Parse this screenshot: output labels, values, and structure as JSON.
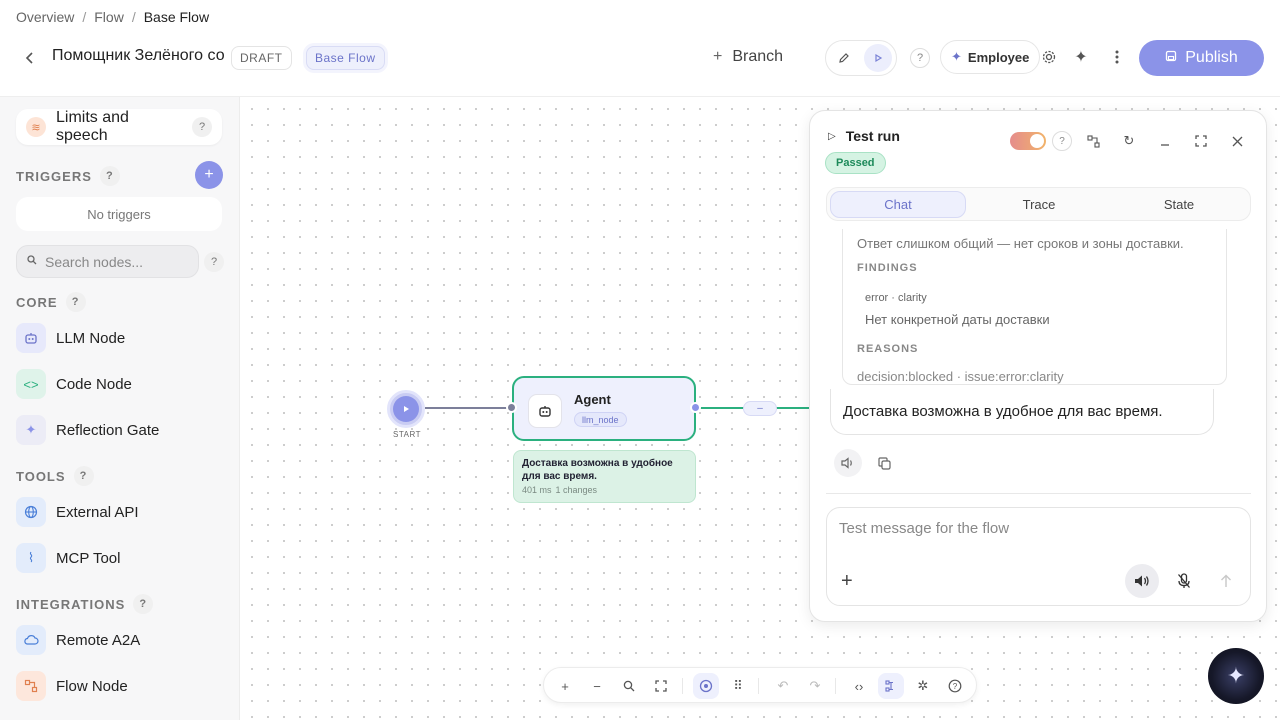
{
  "breadcrumb": {
    "items": [
      "Overview",
      "Flow"
    ],
    "current": "Base Flow",
    "separator": "/"
  },
  "header": {
    "flow_title": "Помощник Зелёного со",
    "draft_label": "DRAFT",
    "base_flow_label": "Base Flow",
    "branch_label": "Branch",
    "employee_label": "Employee",
    "publish_label": "Publish",
    "help_label": "?",
    "icons": [
      "chevron-left-icon",
      "pencil-icon",
      "play-icon",
      "sparkle-icon",
      "gear-icon",
      "magic-icon",
      "kebab-icon",
      "save-icon"
    ]
  },
  "sidebar": {
    "limits_label": "Limits and speech",
    "help_label": "?",
    "triggers_heading": "TRIGGERS",
    "add_trigger_label": "+",
    "no_triggers_label": "No triggers",
    "search_placeholder": "Search nodes...",
    "sections": [
      {
        "heading": "CORE",
        "items": [
          {
            "label": "LLM Node",
            "icon": "robot-icon"
          },
          {
            "label": "Code Node",
            "icon": "code-icon"
          },
          {
            "label": "Reflection Gate",
            "icon": "sparkle-icon"
          }
        ]
      },
      {
        "heading": "TOOLS",
        "items": [
          {
            "label": "External API",
            "icon": "globe-icon"
          },
          {
            "label": "MCP Tool",
            "icon": "plug-icon"
          }
        ]
      },
      {
        "heading": "INTEGRATIONS",
        "items": [
          {
            "label": "Remote A2A",
            "icon": "cloud-icon"
          },
          {
            "label": "Flow Node",
            "icon": "flow-icon"
          }
        ]
      }
    ]
  },
  "canvas": {
    "start_label": "START",
    "agent": {
      "title": "Agent",
      "tag": "llm_node"
    },
    "output": {
      "text": "Доставка возможна в удобное для вас время.",
      "duration": "401 ms",
      "changes": "1 changes"
    },
    "mid_node_label": "–",
    "colors": {
      "accent": "#8b93e8",
      "success_edge": "#2bb07f",
      "edge": "#7c7f9a"
    }
  },
  "toolbar": {
    "icons": [
      "zoom-in-icon",
      "zoom-out-icon",
      "search-icon",
      "fit-view-icon",
      "target-icon",
      "grid-icon",
      "undo-icon",
      "redo-icon",
      "code-icon",
      "layout-icon",
      "network-icon",
      "help-icon"
    ]
  },
  "panel": {
    "title": "Test run",
    "status": "Passed",
    "help_label": "?",
    "tabs": [
      "Chat",
      "Trace",
      "State"
    ],
    "active_tab": "Chat",
    "evaluation": {
      "summary": "Ответ слишком общий — нет сроков и зоны доставки.",
      "findings_heading": "FINDINGS",
      "finding_category": "error · clarity",
      "finding_text": "Нет конкретной даты доставки",
      "reasons_heading": "REASONS",
      "reasons_text": "decision:blocked · issue:error:clarity"
    },
    "message": "Доставка возможна в удобное для вас время.",
    "composer_placeholder": "Test message for the flow"
  }
}
